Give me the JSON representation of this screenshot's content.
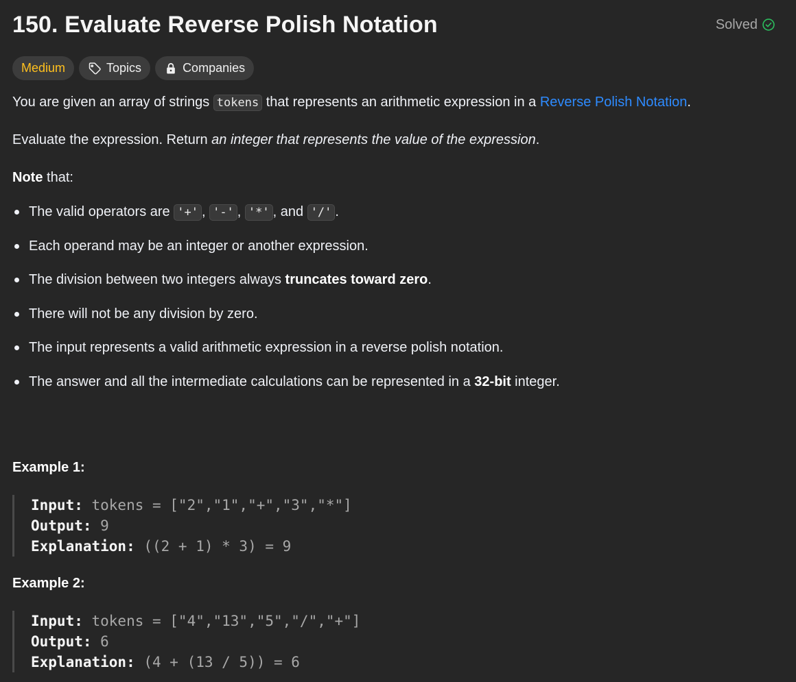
{
  "header": {
    "title": "150. Evaluate Reverse Polish Notation",
    "status": "Solved",
    "status_icon": "check-circle-icon",
    "status_color": "#2cbb5d"
  },
  "tags": {
    "difficulty": "Medium",
    "difficulty_color": "#ffc01e",
    "topics": "Topics",
    "companies": "Companies"
  },
  "description": {
    "p1_before": "You are given an array of strings ",
    "p1_code": "tokens",
    "p1_middle": " that represents an arithmetic expression in a ",
    "p1_link": "Reverse Polish Notation",
    "p1_after": ".",
    "p2_before": "Evaluate the expression. Return ",
    "p2_em": "an integer that represents the value of the expression",
    "p2_after": ".",
    "note_bold": "Note",
    "note_after": " that:"
  },
  "notes": {
    "n1_before": "The valid operators are ",
    "n1_op1": "'+'",
    "n1_sep1": ", ",
    "n1_op2": "'-'",
    "n1_sep2": ", ",
    "n1_op3": "'*'",
    "n1_sep3": ", and ",
    "n1_op4": "'/'",
    "n1_after": ".",
    "n2": "Each operand may be an integer or another expression.",
    "n3_before": "The division between two integers always ",
    "n3_bold": "truncates toward zero",
    "n3_after": ".",
    "n4": "There will not be any division by zero.",
    "n5": "The input represents a valid arithmetic expression in a reverse polish notation.",
    "n6_before": "The answer and all the intermediate calculations can be represented in a ",
    "n6_bold": "32-bit",
    "n6_after": " integer."
  },
  "examples": [
    {
      "title": "Example 1:",
      "input_label": "Input:",
      "input": " tokens = [\"2\",\"1\",\"+\",\"3\",\"*\"]",
      "output_label": "Output:",
      "output": " 9",
      "explanation_label": "Explanation:",
      "explanation": " ((2 + 1) * 3) = 9"
    },
    {
      "title": "Example 2:",
      "input_label": "Input:",
      "input": " tokens = [\"4\",\"13\",\"5\",\"/\",\"+\"]",
      "output_label": "Output:",
      "output": " 6",
      "explanation_label": "Explanation:",
      "explanation": " (4 + (13 / 5)) = 6"
    }
  ]
}
